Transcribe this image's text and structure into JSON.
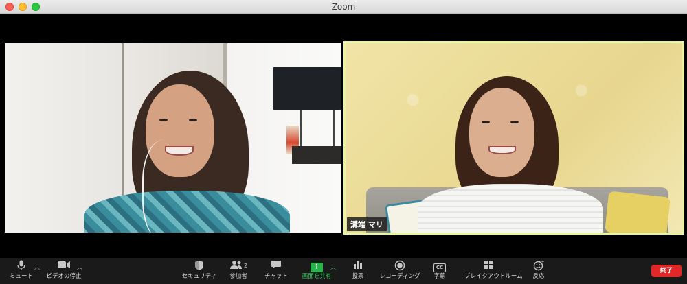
{
  "window": {
    "title": "Zoom"
  },
  "participants": [
    {
      "id": "self",
      "name": ""
    },
    {
      "id": "remote",
      "name": "溝端 マリ"
    }
  ],
  "toolbar": {
    "mute": {
      "label": "ミュート",
      "icon": "microphone-icon"
    },
    "video": {
      "label": "ビデオの停止",
      "icon": "video-camera-icon"
    },
    "security": {
      "label": "セキュリティ",
      "icon": "shield-icon"
    },
    "participants": {
      "label": "参加者",
      "count": "2",
      "icon": "people-icon"
    },
    "chat": {
      "label": "チャット",
      "icon": "chat-bubble-icon"
    },
    "share": {
      "label": "画面を共有",
      "icon": "share-arrow-icon"
    },
    "polls": {
      "label": "投票",
      "icon": "bar-chart-icon"
    },
    "record": {
      "label": "レコーディング",
      "icon": "record-icon"
    },
    "captions": {
      "label": "字幕",
      "badge": "CC",
      "icon": "cc-icon"
    },
    "breakout": {
      "label": "ブレイクアウトルーム",
      "icon": "grid-icon"
    },
    "reactions": {
      "label": "反応",
      "icon": "smiley-icon"
    },
    "end": {
      "label": "終了"
    }
  },
  "colors": {
    "share_accent": "#33c45b",
    "end_button": "#e02828",
    "active_speaker_border": "#e7f3a6"
  }
}
